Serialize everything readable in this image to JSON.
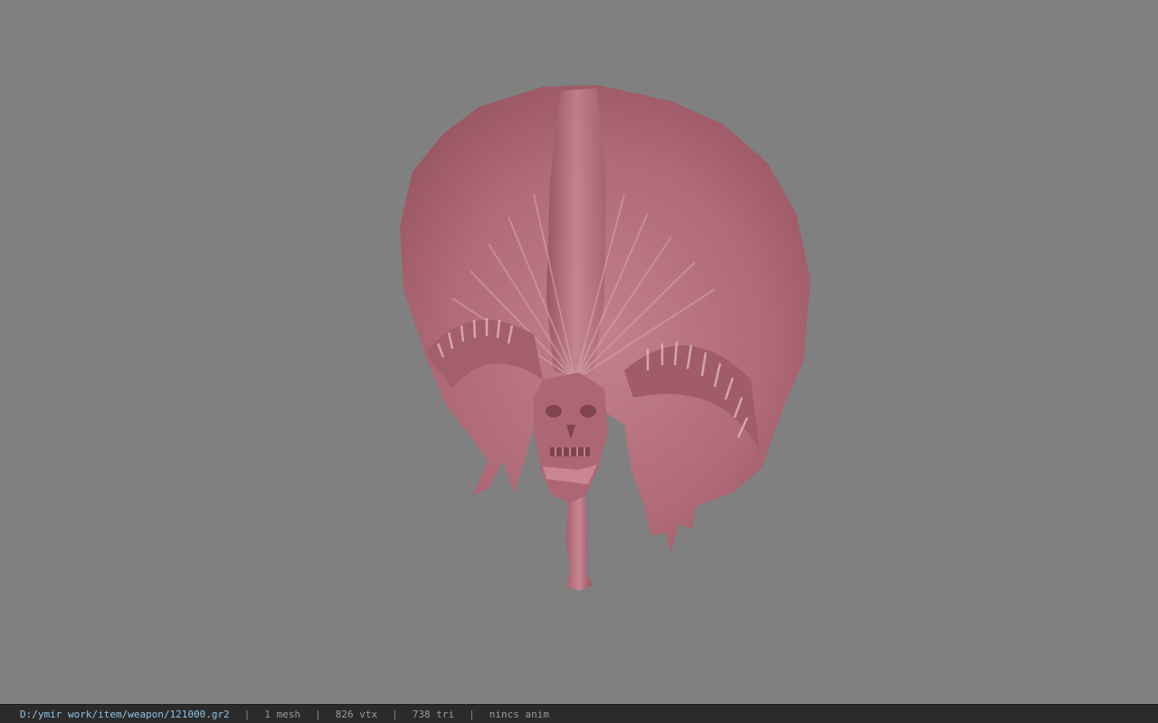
{
  "viewer": {
    "background_color": "#808080",
    "model_color": "#b56c7a",
    "model_icon": "fan-skull-weapon-model"
  },
  "status": {
    "file_path": "D:/ymir work/item/weapon/121000.gr2",
    "mesh_count": "1 mesh",
    "vertex_count": "826 vtx",
    "triangle_count": "738 tri",
    "anim_status": "nincs anim",
    "separator": "|"
  }
}
